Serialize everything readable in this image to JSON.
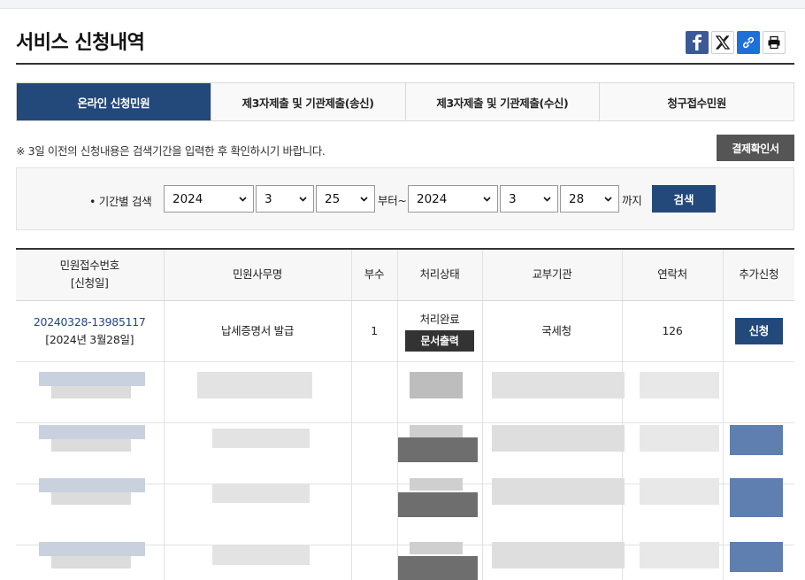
{
  "page": {
    "title": "서비스 신청내역"
  },
  "share": {
    "facebook_icon": "facebook-icon",
    "x_icon": "x-icon",
    "link_icon": "link-icon",
    "print_icon": "print-icon"
  },
  "tabs": [
    {
      "label": "온라인 신청민원",
      "active": true
    },
    {
      "label": "제3자제출 및 기관제출(송신)",
      "active": false
    },
    {
      "label": "제3자제출 및 기관제출(수신)",
      "active": false
    },
    {
      "label": "청구접수민원",
      "active": false
    }
  ],
  "notice": "※ 3일 이전의 신청내용은 검색기간을 입력한 후 확인하시기 바랍니다.",
  "confirm_button": "결제확인서",
  "search": {
    "label": "• 기간별 검색",
    "from_year": "2024",
    "from_month": "3",
    "from_day": "25",
    "from_suffix": "부터~",
    "to_year": "2024",
    "to_month": "3",
    "to_day": "28",
    "to_suffix": "까지",
    "button": "검색"
  },
  "table": {
    "headers": {
      "receipt_no_line1": "민원접수번호",
      "receipt_no_line2": "[신청일]",
      "task": "민원사무명",
      "copies": "부수",
      "status": "처리상태",
      "agency": "교부기관",
      "contact": "연락처",
      "extra": "추가신청"
    },
    "rows": [
      {
        "receipt_no": "20240328-13985117",
        "date": "[2024년 3월28일]",
        "task": "납세증명서 발급",
        "copies": "1",
        "status": "처리완료",
        "status_button": "문서출력",
        "agency": "국세청",
        "contact": "126",
        "extra_button": "신청"
      }
    ]
  },
  "colors": {
    "primary": "#23487a",
    "dark_button": "#333333",
    "gray_button": "#555555"
  }
}
